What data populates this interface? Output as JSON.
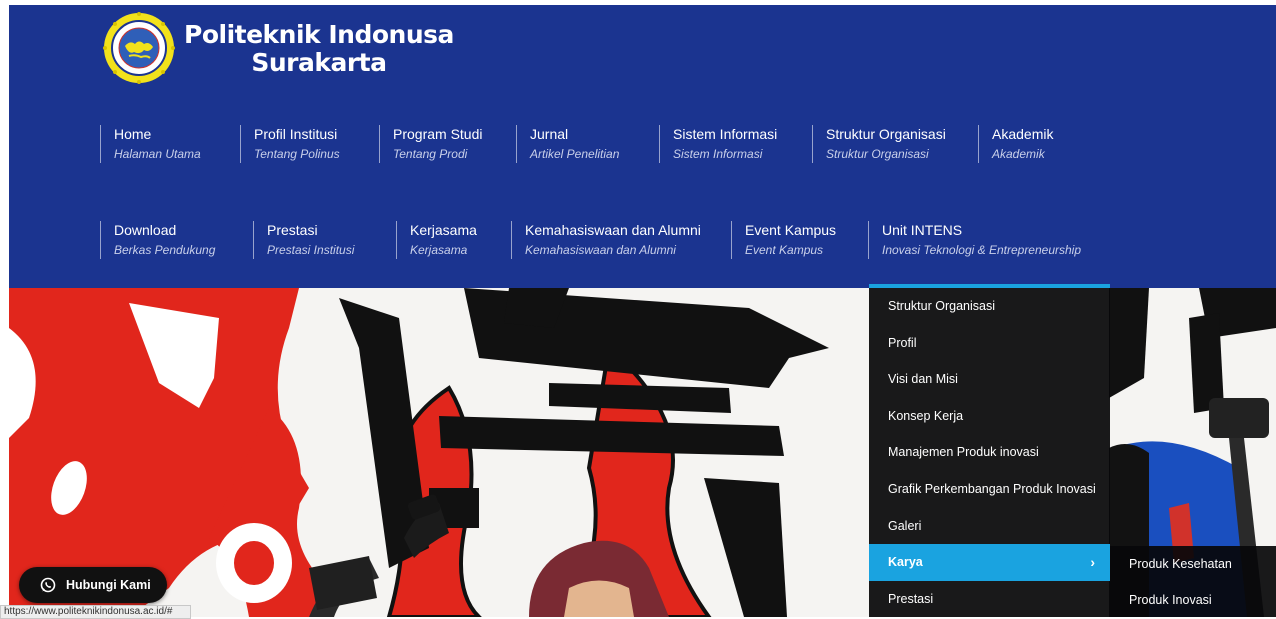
{
  "brand": {
    "line1": "Politeknik Indonusa",
    "line2": "Surakarta",
    "logo_icon": "polinus-logo-icon"
  },
  "nav": {
    "row1": [
      {
        "title": "Home",
        "sub": "Halaman Utama"
      },
      {
        "title": "Profil Institusi",
        "sub": "Tentang Polinus"
      },
      {
        "title": "Program Studi",
        "sub": "Tentang Prodi"
      },
      {
        "title": "Jurnal",
        "sub": "Artikel Penelitian"
      },
      {
        "title": "Sistem Informasi",
        "sub": "Sistem Informasi"
      },
      {
        "title": "Struktur Organisasi",
        "sub": "Struktur Organisasi"
      },
      {
        "title": "Akademik",
        "sub": "Akademik"
      }
    ],
    "row2": [
      {
        "title": "Download",
        "sub": "Berkas Pendukung"
      },
      {
        "title": "Prestasi",
        "sub": "Prestasi Institusi"
      },
      {
        "title": "Kerjasama",
        "sub": "Kerjasama"
      },
      {
        "title": "Kemahasiswaan dan Alumni",
        "sub": "Kemahasiswaan dan Alumni"
      },
      {
        "title": "Event Kampus",
        "sub": "Event Kampus"
      },
      {
        "title": "Unit INTENS",
        "sub": "Inovasi Teknologi & Entrepreneurship"
      }
    ]
  },
  "dropdown": {
    "items": [
      "Struktur Organisasi",
      "Profil",
      "Visi dan Misi",
      "Konsep Kerja",
      "Manajemen Produk inovasi",
      "Grafik Perkembangan Produk Inovasi",
      "Galeri",
      "Karya",
      "Prestasi"
    ],
    "active": "Karya",
    "chevron": "›"
  },
  "submenu": {
    "items": [
      "Produk Kesehatan",
      "Produk Inovasi"
    ]
  },
  "whatsapp": {
    "label": "Hubungi Kami",
    "icon": "whatsapp-icon"
  },
  "status_bar": {
    "url": "https://www.politeknikindonusa.ac.id/#"
  },
  "colors": {
    "header_bg": "#1b3490",
    "accent": "#1aa3e0",
    "dropdown_bg": "#08080a"
  }
}
